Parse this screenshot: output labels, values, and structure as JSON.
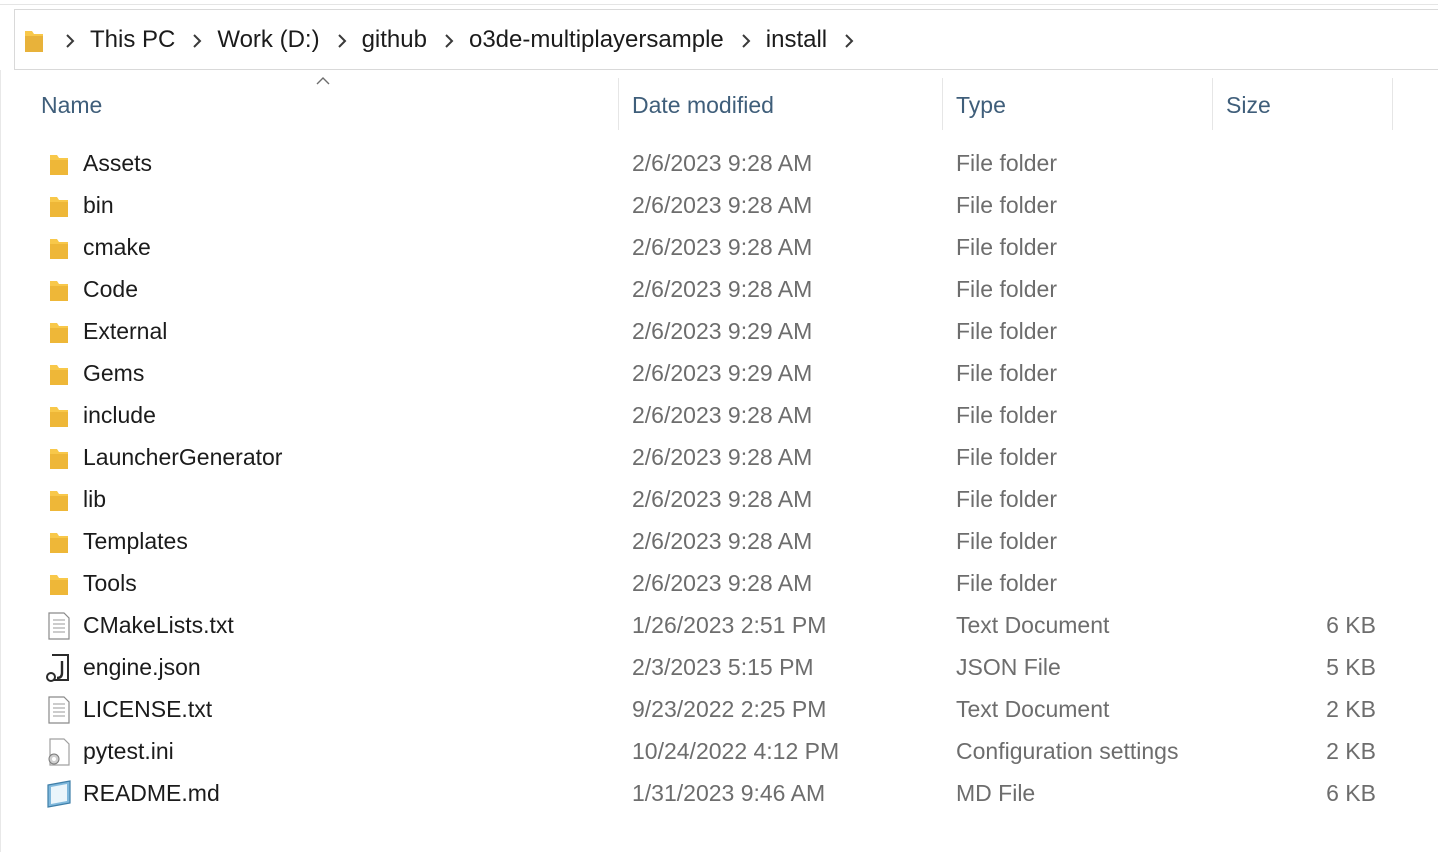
{
  "breadcrumb": [
    "This PC",
    "Work (D:)",
    "github",
    "o3de-multiplayersample",
    "install"
  ],
  "columns": {
    "name": "Name",
    "date": "Date modified",
    "type": "Type",
    "size": "Size"
  },
  "sort": {
    "column": "name",
    "direction": "ascending"
  },
  "files": [
    {
      "name": "Assets",
      "date": "2/6/2023 9:28 AM",
      "type": "File folder",
      "size": "",
      "icon": "folder-icon"
    },
    {
      "name": "bin",
      "date": "2/6/2023 9:28 AM",
      "type": "File folder",
      "size": "",
      "icon": "folder-icon"
    },
    {
      "name": "cmake",
      "date": "2/6/2023 9:28 AM",
      "type": "File folder",
      "size": "",
      "icon": "folder-icon"
    },
    {
      "name": "Code",
      "date": "2/6/2023 9:28 AM",
      "type": "File folder",
      "size": "",
      "icon": "folder-icon"
    },
    {
      "name": "External",
      "date": "2/6/2023 9:29 AM",
      "type": "File folder",
      "size": "",
      "icon": "folder-icon"
    },
    {
      "name": "Gems",
      "date": "2/6/2023 9:29 AM",
      "type": "File folder",
      "size": "",
      "icon": "folder-icon"
    },
    {
      "name": "include",
      "date": "2/6/2023 9:28 AM",
      "type": "File folder",
      "size": "",
      "icon": "folder-icon"
    },
    {
      "name": "LauncherGenerator",
      "date": "2/6/2023 9:28 AM",
      "type": "File folder",
      "size": "",
      "icon": "folder-icon"
    },
    {
      "name": "lib",
      "date": "2/6/2023 9:28 AM",
      "type": "File folder",
      "size": "",
      "icon": "folder-icon"
    },
    {
      "name": "Templates",
      "date": "2/6/2023 9:28 AM",
      "type": "File folder",
      "size": "",
      "icon": "folder-icon"
    },
    {
      "name": "Tools",
      "date": "2/6/2023 9:28 AM",
      "type": "File folder",
      "size": "",
      "icon": "folder-icon"
    },
    {
      "name": "CMakeLists.txt",
      "date": "1/26/2023 2:51 PM",
      "type": "Text Document",
      "size": "6 KB",
      "icon": "text-file-icon"
    },
    {
      "name": "engine.json",
      "date": "2/3/2023 5:15 PM",
      "type": "JSON File",
      "size": "5 KB",
      "icon": "json-file-icon"
    },
    {
      "name": "LICENSE.txt",
      "date": "9/23/2022 2:25 PM",
      "type": "Text Document",
      "size": "2 KB",
      "icon": "text-file-icon"
    },
    {
      "name": "pytest.ini",
      "date": "10/24/2022 4:12 PM",
      "type": "Configuration settings",
      "size": "2 KB",
      "icon": "config-file-icon"
    },
    {
      "name": "README.md",
      "date": "1/31/2023 9:46 AM",
      "type": "MD File",
      "size": "6 KB",
      "icon": "notepad-file-icon"
    }
  ],
  "colors": {
    "folder": "#f8c84a",
    "folder_dark": "#e6a92a",
    "header_text": "#3f5e7a",
    "secondary_text": "#6d6d6d"
  }
}
